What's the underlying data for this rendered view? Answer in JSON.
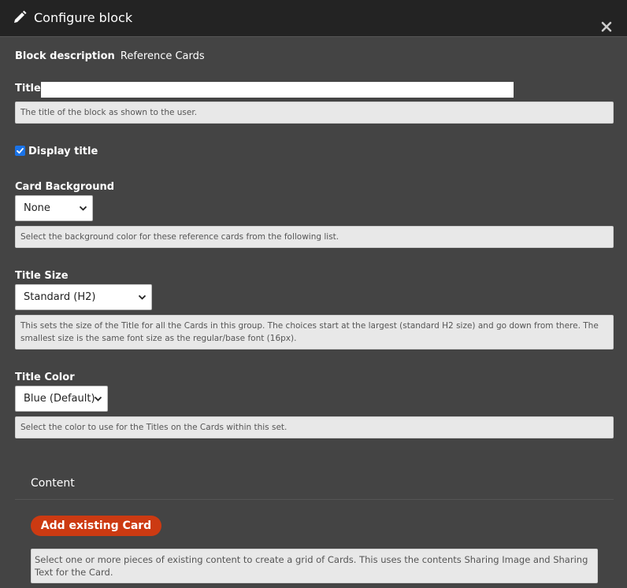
{
  "dialog": {
    "title": "Configure block",
    "icons": {
      "title_icon": "pencil-icon",
      "close_icon": "close-icon"
    }
  },
  "block_description": {
    "label": "Block description",
    "value": "Reference Cards"
  },
  "title_field": {
    "label": "Title",
    "value": "",
    "help": "The title of the block as shown to the user."
  },
  "display_title": {
    "label": "Display title",
    "checked": true
  },
  "card_background": {
    "label": "Card Background",
    "selected": "None",
    "help": "Select the background color for these reference cards from the following list."
  },
  "title_size": {
    "label": "Title Size",
    "selected": "Standard (H2)",
    "help": "This sets the size of the Title for all the Cards in this group. The choices start at the largest (standard H2 size) and go down from there. The smallest size is the same font size as the regular/base font (16px)."
  },
  "title_color": {
    "label": "Title Color",
    "selected": "Blue (Default)",
    "help": "Select the color to use for the Titles on the Cards within this set."
  },
  "content_section": {
    "heading": "Content",
    "add_button_label": "Add existing Card",
    "help": "Select one or more pieces of existing content to create a grid of Cards. This uses the contents Sharing Image and Sharing Text for the Card."
  },
  "colors": {
    "header_bg": "#232323",
    "body_bg": "#444444",
    "accent_button": "#cc3a12",
    "checkbox": "#1a73e8"
  }
}
